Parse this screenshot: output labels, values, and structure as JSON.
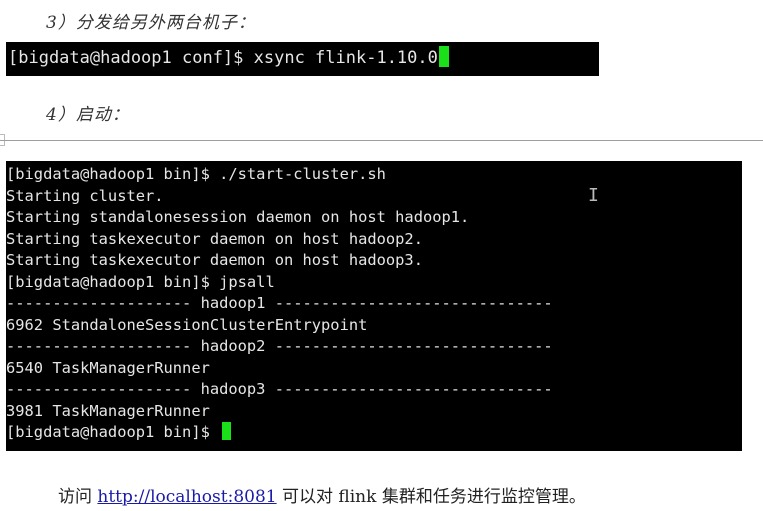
{
  "step3": {
    "label": "3）分发给另外两台机子："
  },
  "terminal1": {
    "command_line": "[bigdata@hadoop1 conf]$ xsync flink-1.10.0"
  },
  "step4": {
    "label": "4）启动："
  },
  "terminal2": {
    "lines": [
      "[bigdata@hadoop1 bin]$ ./start-cluster.sh",
      "Starting cluster.",
      "Starting standalonesession daemon on host hadoop1.",
      "Starting taskexecutor daemon on host hadoop2.",
      "Starting taskexecutor daemon on host hadoop3.",
      "[bigdata@hadoop1 bin]$ jpsall",
      "-------------------- hadoop1 ------------------------------",
      "6962 StandaloneSessionClusterEntrypoint",
      "-------------------- hadoop2 ------------------------------",
      "6540 TaskManagerRunner",
      "-------------------- hadoop3 ------------------------------",
      "3981 TaskManagerRunner"
    ],
    "prompt": "[bigdata@hadoop1 bin]$ "
  },
  "footer": {
    "prefix": "访问 ",
    "link_text": "http://localhost:8081",
    "suffix": " 可以对 flink 集群和任务进行监控管理。"
  },
  "colors": {
    "terminal_bg": "#000000",
    "terminal_text": "#e6e6e6",
    "cursor": "#19e019",
    "link": "#1a1aa8"
  },
  "icons": {
    "cursor": "text-ibeam-icon"
  }
}
